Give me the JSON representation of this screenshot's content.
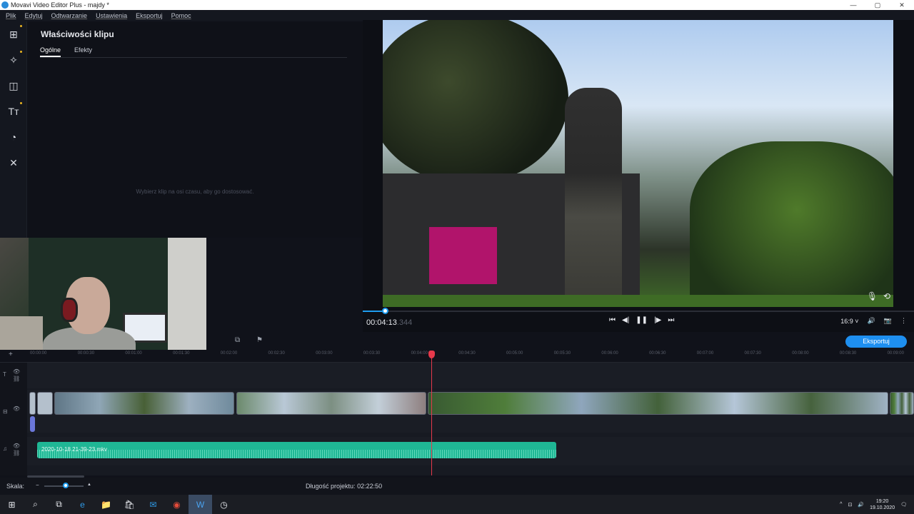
{
  "window": {
    "title": "Movavi Video Editor Plus - majdy *"
  },
  "window_buttons": {
    "minimize": "—",
    "maximize": "▢",
    "close": "✕"
  },
  "menu": [
    "Plik",
    "Edytuj",
    "Odtwarzanie",
    "Ustawienia",
    "Eksportuj",
    "Pomoc"
  ],
  "toolbar": {
    "icons": [
      "import-icon",
      "magic-wand-icon",
      "transitions-icon",
      "titles-icon",
      "stickers-icon",
      "tools-icon"
    ],
    "glyphs": [
      "⊞",
      "✧",
      "◫",
      "Tт",
      "◔",
      "✕"
    ]
  },
  "properties": {
    "title": "Właściwości klipu",
    "tabs": [
      "Ogólne",
      "Efekty"
    ],
    "hint": "Wybierz klip na osi czasu, aby go dostosować."
  },
  "player": {
    "timecode": "00:04:13",
    "timecode_ms": ".344",
    "progress": 0.04,
    "aspect": "16:9",
    "transport_glyphs": [
      "⏮",
      "◀|",
      "❚❚",
      "|▶",
      "⏭"
    ],
    "icons": {
      "volume": "🔊",
      "snapshot": "📷",
      "more": "⋮",
      "mic": "🎙",
      "loop": "⟲",
      "aspect_chevron": "˅"
    }
  },
  "timeline": {
    "export_label": "Eksportuj",
    "ticks": [
      "00:00:00",
      "00:00:30",
      "00:01:00",
      "00:01:30",
      "00:02:00",
      "00:02:30",
      "00:03:00",
      "00:03:30",
      "00:04:00",
      "00:04:30",
      "00:05:00",
      "00:05:30",
      "00:06:00",
      "00:06:30",
      "00:07:00",
      "00:07:30",
      "00:08:00",
      "00:08:30",
      "00:09:00"
    ],
    "audio_clip_name": "2020-10-18 21-39-23.mkv",
    "glyphs": {
      "layout": "⧉",
      "marker": "⚑",
      "add": "+",
      "title_track": "T",
      "visible": "👁",
      "link": "⛓",
      "video_track": "⊟",
      "audio_track": "♫"
    }
  },
  "status": {
    "scale_label": "Skala:",
    "scale_minus": "−",
    "scale_plus": "▲",
    "scale_value": 0.55,
    "project_length_label": "Długość projektu:",
    "project_length": "02:22:50"
  },
  "taskbar": {
    "glyphs": [
      "⊞",
      "⌕",
      "⧉",
      "e",
      "📁",
      "🛍",
      "✉",
      "◉",
      "W",
      "◷"
    ],
    "tray_glyphs": [
      "^",
      "⊡",
      "🔊",
      "🗨"
    ],
    "time": "19:20",
    "date": "19.10.2020"
  }
}
